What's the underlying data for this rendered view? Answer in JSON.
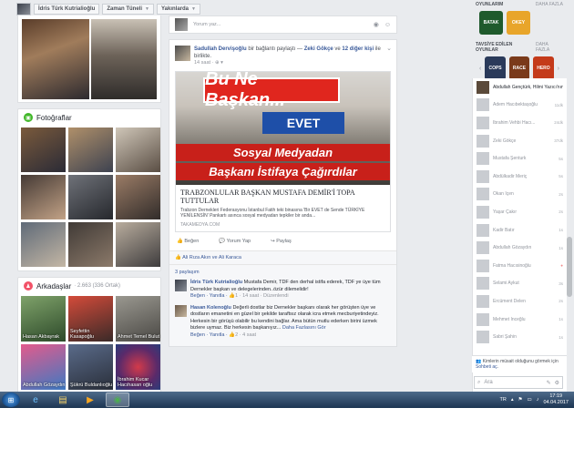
{
  "topbar": {
    "name": "İdris Türk Kutrialioğlu",
    "timeline": "Zaman Tüneli",
    "recent": "Yakınlarda"
  },
  "photos": {
    "title": "Fotoğraflar"
  },
  "friends": {
    "title": "Arkadaşlar",
    "count": "· 2.663 (336 Ortak)",
    "items": [
      "Hasan Akbayrak",
      "Seyfettin Kasapoğlu",
      "Ahmet Temel Bulut",
      "Abdullah Gözaydın",
      "Şükrü Buldanlıoğlu",
      "İbrahim Kucar Hacıhasan oğlu"
    ]
  },
  "composer": {
    "placeholder": "Yorum yaz..."
  },
  "post": {
    "author": "Sadullah Dervişoğlu",
    "action": "bir bağlantı paylaştı — ",
    "with": "Zeki Gökçe",
    "and": " ve ",
    "others": "12 diğer kişi",
    "with_tail": " ile birlikte.",
    "time": "14 saat",
    "privacy": "· ⊕ ▾",
    "image_banner": "Bu Ne Başkan...",
    "image_sign": "EVET",
    "image_strip1": "Sosyal Medyadan",
    "image_strip2": "Başkanı İstifaya Çağırdılar",
    "title": "TRABZONLULAR BAŞKAN MUSTAFA DEMİR'İ TOPA TUTTULAR",
    "desc": "Trabzon Dernekleri Federasyonu İstanbul Fatih teki binasına 'Bir EVET de Sende TÜRKİYE YENİLENSİN' Pankartı asınca sosyal medyadan tepkiler bir anda...",
    "url": "TAKAMEDYA.COM",
    "like": "Beğen",
    "comment": "Yorum Yap",
    "share": "Paylaş",
    "likers": "Ali Rıza Akın ve Ali Karaca",
    "comment_count": "3 paylaşım"
  },
  "comments": [
    {
      "name": "İdris Türk Kutrialioğlu",
      "text": " Mustafa Demir, TDF den derhal istifa ederek, TDF ye üye tüm Dernekler başkan ve delegelerinden..özür dilemelidir!",
      "actions": "Beğen · Yanıtla · ",
      "likes": "1",
      "time": " · 14 saat · Düzenlendi"
    },
    {
      "name": "Hasan Kolenoğlu",
      "text": " Değerli dostlar biz Dernekler başkanı olarak her görüşten üye ve dostların emanetini en güzel bir şekilde taraftsız olarak icra etmek mecburiyetindeyiz. Herkesin bir görüşü olabilir bu kendini bağlar. Ama bütün mutlu ederken birini üzmek bizlere uymaz. Biz herkesin başkanıyız... ",
      "more": "Daha Fazlasını Gör",
      "actions": "Beğen · Yanıtla · ",
      "likes": "2",
      "time": " · 4 saat"
    }
  ],
  "right": {
    "games_title": "OYUNLARIM",
    "games_more": "DAHA FAZLA",
    "games": [
      "BATAK",
      "OKEY"
    ],
    "friends_games_title": "TAVSİYE EDİLEN OYUNLAR",
    "friends_games_more": "DAHA FAZLA",
    "friend_games": [
      "COPS",
      "RACE",
      "HERO"
    ]
  },
  "contacts": [
    {
      "name": "Abdullah Gençtürk, Hilmi Yazıcı'nın gönderisini",
      "time": "",
      "active": true
    },
    {
      "name": "Adem Hacıbektaşoğlu",
      "time": "11dk"
    },
    {
      "name": "İbrahim Vehbi Hacı...",
      "time": "24dk"
    },
    {
      "name": "Zeki Gökçe",
      "time": "37dk"
    },
    {
      "name": "Mustafa Şenturk",
      "time": "5s"
    },
    {
      "name": "Abdülkadir Meriç",
      "time": "5s"
    },
    {
      "name": "Okan Içen",
      "time": "2s"
    },
    {
      "name": "Yaşar Çakır",
      "time": "2s"
    },
    {
      "name": "Kadir Batır",
      "time": "1s"
    },
    {
      "name": "Abdullah Gözaydın",
      "time": "1s"
    },
    {
      "name": "Fatma Hacısinoğlu",
      "time": "●"
    },
    {
      "name": "Selami Aykut",
      "time": "3s"
    },
    {
      "name": "Ercüment Delen",
      "time": "2s"
    },
    {
      "name": "Mehmet İnceğlu",
      "time": "1s"
    },
    {
      "name": "Sabri Şahin",
      "time": "1s"
    }
  ],
  "chat_note": {
    "text": "Kimlerin müsait olduğunu görmek için ",
    "link": "Sohbeti aç",
    "tail": "."
  },
  "chat_search": {
    "placeholder": "Ara"
  },
  "tray": {
    "lang": "TR",
    "time": "17:19",
    "date": "04.04.2017"
  }
}
